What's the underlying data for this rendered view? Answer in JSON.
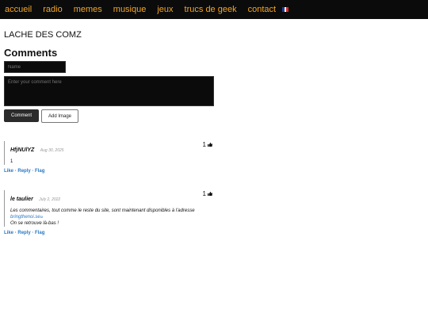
{
  "nav": {
    "items": [
      "accueil",
      "radio",
      "memes",
      "musique",
      "jeux",
      "trucs de geek",
      "contact"
    ],
    "flag_icon": "french-flag-icon",
    "accent_color": "#f5a623"
  },
  "page": {
    "title": "LACHE DES COMZ"
  },
  "comments_section": {
    "heading": "Comments",
    "name_placeholder": "Name",
    "comment_placeholder": "Enter your comment here",
    "comment_button": "Comment",
    "add_image_button": "Add Image"
  },
  "comments": [
    {
      "author": "HfjNUlYZ",
      "date": "Aug 30, 2025",
      "votes": "1",
      "text_1": "1",
      "actions": {
        "like": "Like",
        "reply": "Reply",
        "flag": "Flag",
        "sep": " · "
      }
    },
    {
      "author": "le taulier",
      "date": "July 2, 2022",
      "votes": "1",
      "text_1": "Les commentaires, tout comme le reste du site, sont maintenant disponibles à l'adresse ",
      "link": "bringthenoi.se",
      "text_2": "On se retrouve là-bas !",
      "actions": {
        "like": "Like",
        "reply": "Reply",
        "flag": "Flag",
        "sep": " · "
      }
    }
  ]
}
